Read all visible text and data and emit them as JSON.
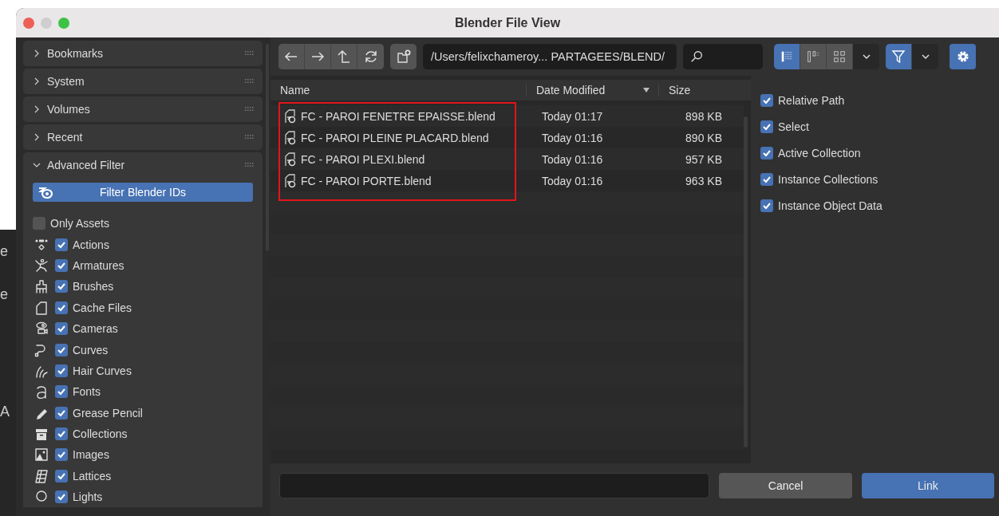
{
  "window": {
    "title": "Blender File View"
  },
  "background_fragments": [
    "e",
    "e",
    "A"
  ],
  "sidebar": {
    "sections": [
      {
        "label": "Bookmarks",
        "expanded": false
      },
      {
        "label": "System",
        "expanded": false
      },
      {
        "label": "Volumes",
        "expanded": false
      },
      {
        "label": "Recent",
        "expanded": false
      },
      {
        "label": "Advanced Filter",
        "expanded": true
      }
    ],
    "filter_button": "Filter Blender IDs",
    "only_assets": {
      "label": "Only Assets",
      "checked": false
    },
    "id_types": [
      {
        "label": "Actions",
        "checked": true
      },
      {
        "label": "Armatures",
        "checked": true
      },
      {
        "label": "Brushes",
        "checked": true
      },
      {
        "label": "Cache Files",
        "checked": true
      },
      {
        "label": "Cameras",
        "checked": true
      },
      {
        "label": "Curves",
        "checked": true
      },
      {
        "label": "Hair Curves",
        "checked": true
      },
      {
        "label": "Fonts",
        "checked": true
      },
      {
        "label": "Grease Pencil",
        "checked": true
      },
      {
        "label": "Collections",
        "checked": true
      },
      {
        "label": "Images",
        "checked": true
      },
      {
        "label": "Lattices",
        "checked": true
      },
      {
        "label": "Lights",
        "checked": true
      }
    ]
  },
  "toolbar": {
    "path": "/Users/felixchameroy... PARTAGEES/BLEND/",
    "display_modes": [
      {
        "selected": true
      },
      {
        "selected": false
      },
      {
        "selected": false
      }
    ],
    "filter_on": true
  },
  "table": {
    "columns": [
      "Name",
      "Date Modified",
      "Size"
    ],
    "rows": [
      {
        "name": "FC - PAROI FENETRE EPAISSE.blend",
        "date": "Today 01:17",
        "size": "898 KB",
        "highlighted": true
      },
      {
        "name": "FC - PAROI PLEINE PLACARD.blend",
        "date": "Today 01:16",
        "size": "890 KB",
        "highlighted": true
      },
      {
        "name": "FC - PAROI PLEXI.blend",
        "date": "Today 01:16",
        "size": "957 KB",
        "highlighted": true
      },
      {
        "name": "FC - PAROI PORTE.blend",
        "date": "Today 01:16",
        "size": "963 KB",
        "highlighted": true
      }
    ]
  },
  "options": [
    {
      "label": "Relative Path",
      "checked": true
    },
    {
      "label": "Select",
      "checked": true
    },
    {
      "label": "Active Collection",
      "checked": true
    },
    {
      "label": "Instance Collections",
      "checked": true
    },
    {
      "label": "Instance Object Data",
      "checked": true
    }
  ],
  "buttons": {
    "cancel": "Cancel",
    "confirm": "Link"
  }
}
